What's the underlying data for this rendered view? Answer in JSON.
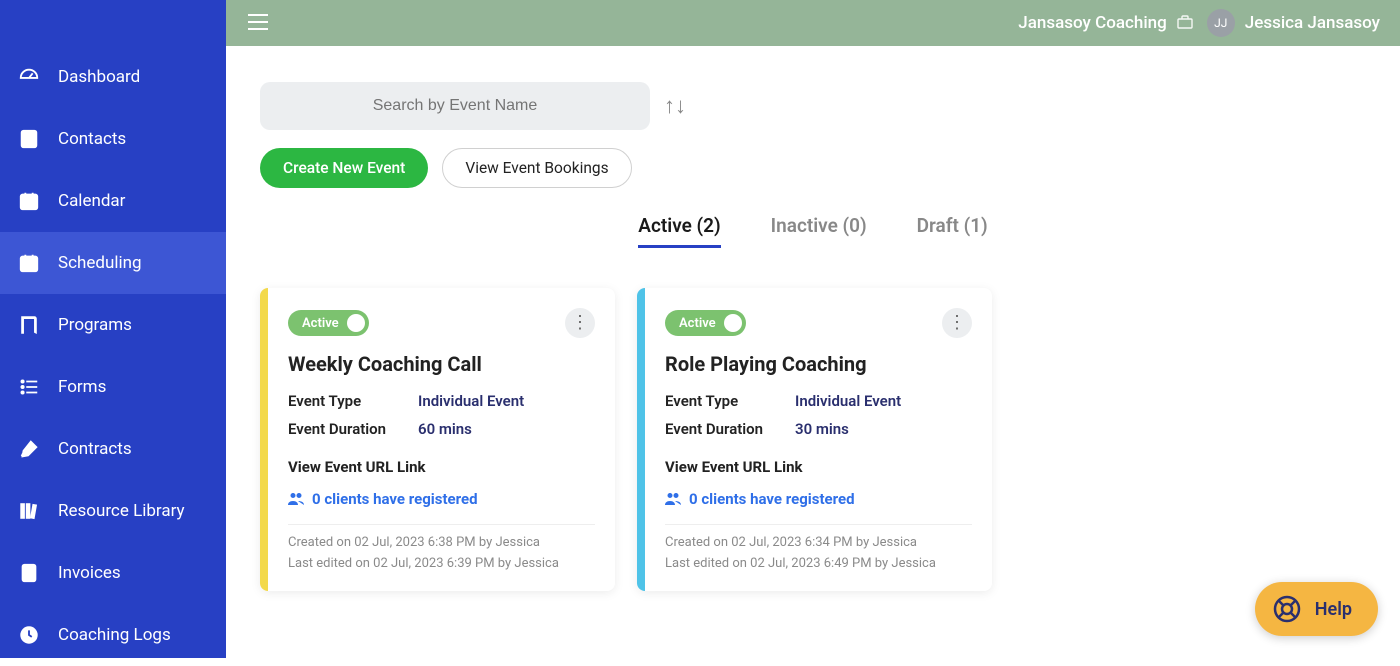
{
  "topbar": {
    "org_name": "Jansasoy Coaching",
    "avatar_initials": "JJ",
    "user_name": "Jessica Jansasoy"
  },
  "sidebar": {
    "items": [
      {
        "label": "Dashboard",
        "icon": "dashboard"
      },
      {
        "label": "Contacts",
        "icon": "contacts"
      },
      {
        "label": "Calendar",
        "icon": "calendar"
      },
      {
        "label": "Scheduling",
        "icon": "scheduling",
        "active": true
      },
      {
        "label": "Programs",
        "icon": "programs"
      },
      {
        "label": "Forms",
        "icon": "forms"
      },
      {
        "label": "Contracts",
        "icon": "contracts"
      },
      {
        "label": "Resource Library",
        "icon": "library"
      },
      {
        "label": "Invoices",
        "icon": "invoices"
      },
      {
        "label": "Coaching Logs",
        "icon": "logs"
      }
    ]
  },
  "search": {
    "placeholder": "Search by Event Name"
  },
  "buttons": {
    "create": "Create New Event",
    "view_bookings": "View Event Bookings"
  },
  "tabs": [
    {
      "label": "Active (2)",
      "active": true
    },
    {
      "label": "Inactive (0)"
    },
    {
      "label": "Draft (1)"
    }
  ],
  "cards": [
    {
      "stripe_color": "#f3d94a",
      "status": "Active",
      "title": "Weekly Coaching Call",
      "event_type_label": "Event Type",
      "event_type_value": "Individual Event",
      "duration_label": "Event Duration",
      "duration_value": "60 mins",
      "url_link": "View Event URL Link",
      "clients_text": "0 clients have registered",
      "created": "Created on 02 Jul, 2023 6:38 PM by Jessica",
      "edited": "Last edited on 02 Jul, 2023 6:39 PM by Jessica"
    },
    {
      "stripe_color": "#4fc3e8",
      "status": "Active",
      "title": "Role Playing Coaching",
      "event_type_label": "Event Type",
      "event_type_value": "Individual Event",
      "duration_label": "Event Duration",
      "duration_value": "30 mins",
      "url_link": "View Event URL Link",
      "clients_text": "0 clients have registered",
      "created": "Created on 02 Jul, 2023 6:34 PM by Jessica",
      "edited": "Last edited on 02 Jul, 2023 6:49 PM by Jessica"
    }
  ],
  "help": {
    "label": "Help"
  }
}
